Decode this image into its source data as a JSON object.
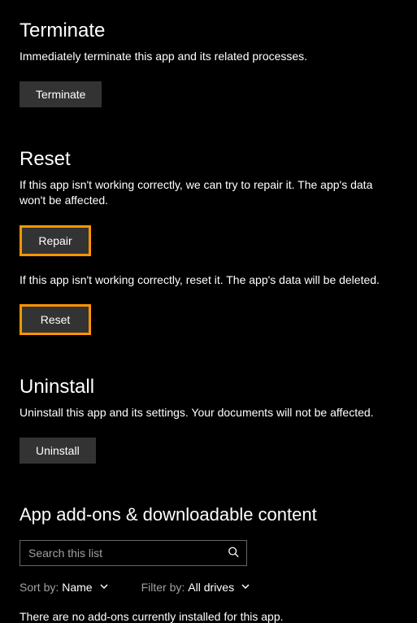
{
  "terminate": {
    "title": "Terminate",
    "description": "Immediately terminate this app and its related processes.",
    "button_label": "Terminate"
  },
  "reset": {
    "title": "Reset",
    "repair_description": "If this app isn't working correctly, we can try to repair it. The app's data won't be affected.",
    "repair_button_label": "Repair",
    "reset_description": "If this app isn't working correctly, reset it. The app's data will be deleted.",
    "reset_button_label": "Reset"
  },
  "uninstall": {
    "title": "Uninstall",
    "description": "Uninstall this app and its settings. Your documents will not be affected.",
    "button_label": "Uninstall"
  },
  "addons": {
    "title": "App add-ons & downloadable content",
    "search_placeholder": "Search this list",
    "sort_label": "Sort by:",
    "sort_value": "Name",
    "filter_label": "Filter by:",
    "filter_value": "All drives",
    "empty_message": "There are no add-ons currently installed for this app."
  },
  "colors": {
    "highlight": "#ff9500"
  }
}
